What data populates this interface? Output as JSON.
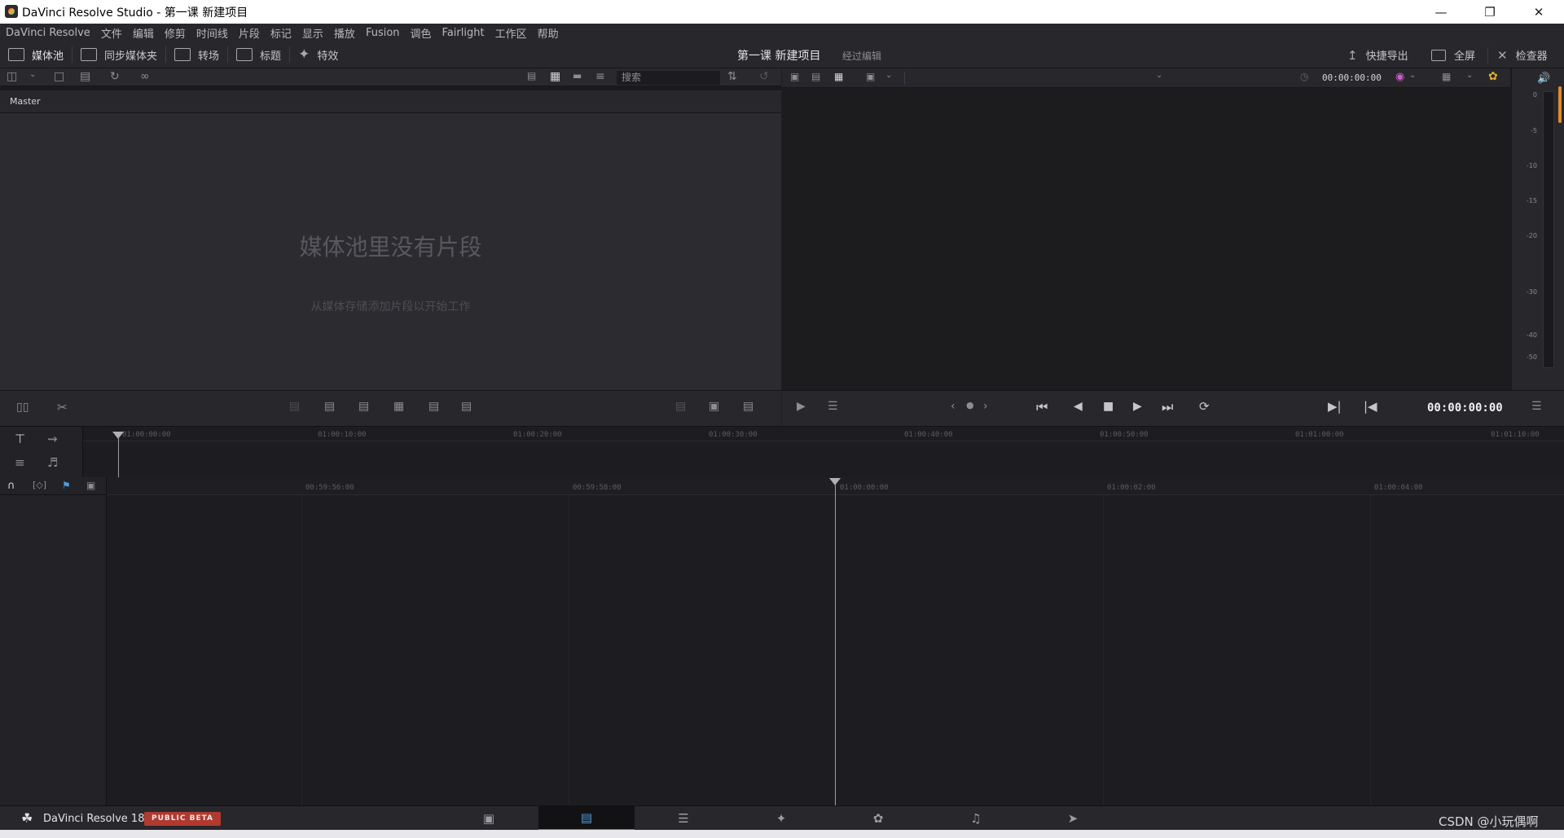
{
  "window": {
    "title": "DaVinci Resolve Studio - 第一课 新建项目"
  },
  "menu": [
    "DaVinci Resolve",
    "文件",
    "编辑",
    "修剪",
    "时间线",
    "片段",
    "标记",
    "显示",
    "播放",
    "Fusion",
    "调色",
    "Fairlight",
    "工作区",
    "帮助"
  ],
  "toolbar": {
    "media_pool": "媒体池",
    "sync_bin": "同步媒体夹",
    "transitions": "转场",
    "titles": "标题",
    "effects": "特效",
    "project_name": "第一课 新建项目",
    "edit_state": "经过编辑",
    "quick_export": "快捷导出",
    "fullscreen": "全屏",
    "inspector": "检查器"
  },
  "media_pool": {
    "bin": "Master",
    "search_placeholder": "搜索",
    "empty_title": "媒体池里没有片段",
    "empty_hint": "从媒体存储添加片段以开始工作"
  },
  "viewer": {
    "timecode_top": "00:00:00:00",
    "timecode_transport": "00:00:00:00"
  },
  "meters": {
    "db_scale": [
      "0",
      "-5",
      "-10",
      "-15",
      "-20",
      "-30",
      "-40",
      "-50"
    ]
  },
  "upper_ruler": [
    "01:00:00:00",
    "01:00:10:00",
    "01:00:20:00",
    "01:00:30:00",
    "01:00:40:00",
    "01:00:50:00",
    "01:01:00:00",
    "01:01:10:00"
  ],
  "lower_ruler": [
    "00:59:56:00",
    "00:59:58:00",
    "01:00:00:00",
    "01:00:02:00",
    "01:00:04:00"
  ],
  "footer": {
    "app": "DaVinci Resolve 18",
    "badge": "PUBLIC BETA",
    "watermark": "CSDN @小玩偶啊"
  },
  "colors": {
    "accent_blue": "#4a9fe0",
    "badge_red": "#b03a30",
    "active_page_underline": "#e04848"
  }
}
